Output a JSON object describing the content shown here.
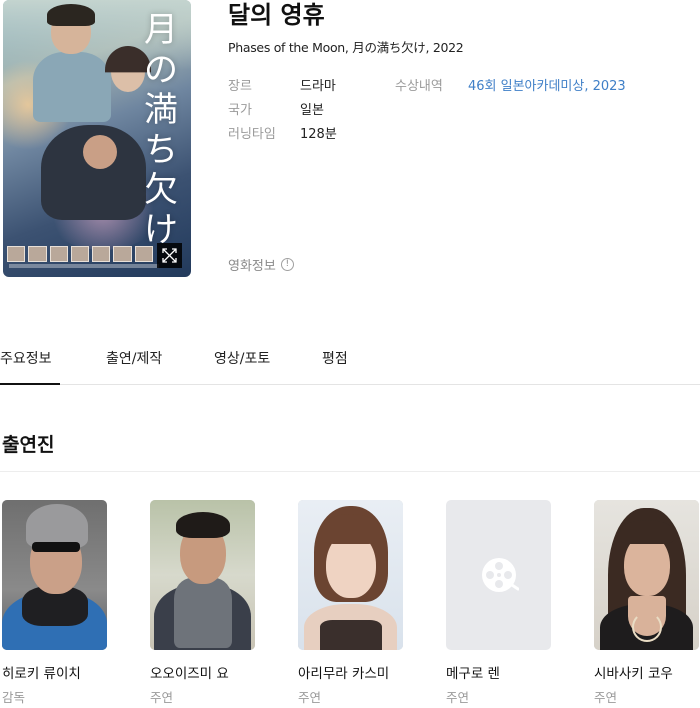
{
  "movie": {
    "title": "달의 영휴",
    "subtitle": "Phases of the Moon, 月の満ち欠け, 2022",
    "poster_title_jp": "月の満ち欠け"
  },
  "info": {
    "genre_label": "장르",
    "genre_value": "드라마",
    "country_label": "국가",
    "country_value": "일본",
    "runtime_label": "러닝타임",
    "runtime_value": "128분",
    "award_label": "수상내역",
    "award_value": "46회 일본아카데미상, 2023",
    "movie_info_label": "영화정보",
    "info_icon": "!"
  },
  "tabs": [
    {
      "label": "주요정보",
      "active": true
    },
    {
      "label": "출연/제작",
      "active": false
    },
    {
      "label": "영상/포토",
      "active": false
    },
    {
      "label": "평점",
      "active": false
    }
  ],
  "cast_section": {
    "title": "출연진",
    "members": [
      {
        "name": "히로키 류이치",
        "role": "감독"
      },
      {
        "name": "오오이즈미 요",
        "role": "주연"
      },
      {
        "name": "아리무라 카스미",
        "role": "주연"
      },
      {
        "name": "메구로 렌",
        "role": "주연"
      },
      {
        "name": "시바사키 코우",
        "role": "주연"
      }
    ]
  },
  "colors": {
    "link": "#3f7fc7",
    "label_gray": "#9a9a9a",
    "active_tab_underline": "#111111"
  },
  "icons": {
    "expand": "expand-arrows-icon",
    "info": "info-circle-icon",
    "no_photo": "film-reel-icon"
  }
}
